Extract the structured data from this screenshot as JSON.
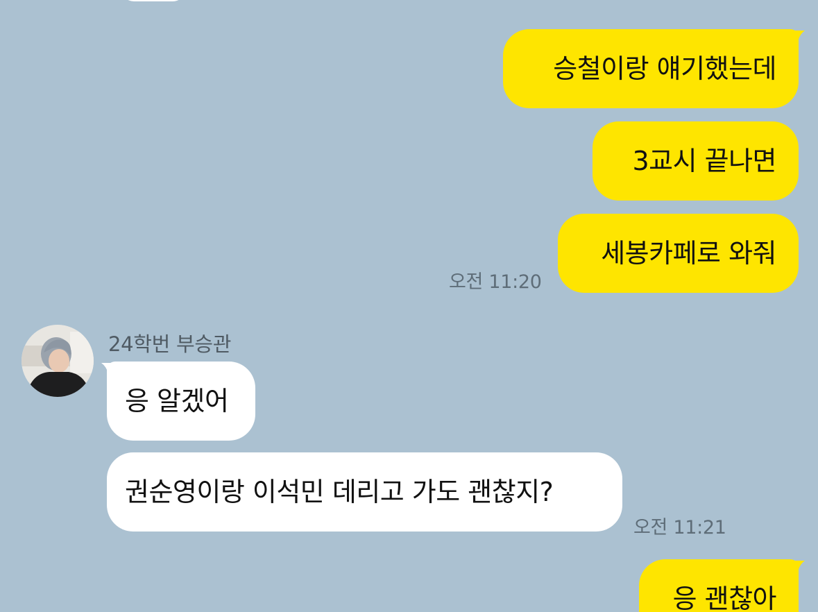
{
  "messages_out_1": [
    {
      "text": "승철이랑 얘기했는데"
    },
    {
      "text": "3교시 끝나면"
    },
    {
      "text": "세봉카페로 와줘"
    }
  ],
  "time_out_1": "오전 11:20",
  "sender": {
    "name": "24학번 부승관"
  },
  "messages_in": [
    {
      "text": "응 알겠어"
    },
    {
      "text": "권순영이랑 이석민 데리고 가도 괜찮지?"
    }
  ],
  "time_in": "오전 11:21",
  "messages_out_2": [
    {
      "text": "응 괜찮아"
    }
  ],
  "colors": {
    "background": "#abc1d1",
    "my_bubble": "#fee500",
    "their_bubble": "#ffffff",
    "timestamp": "#5e6d78"
  }
}
